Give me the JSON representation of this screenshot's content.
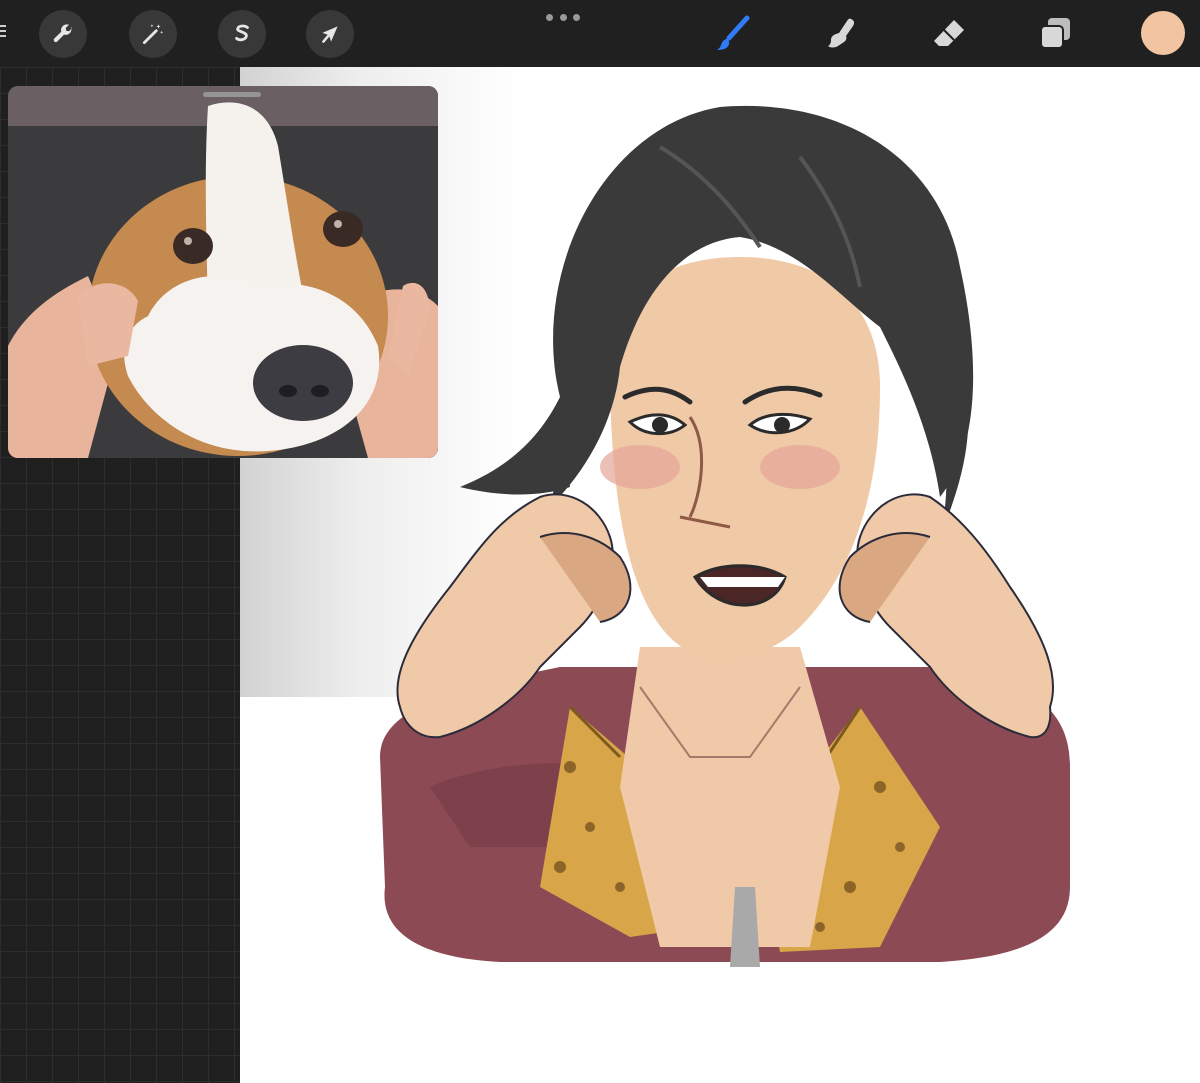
{
  "app": {
    "toolbar": {
      "left_tools": [
        {
          "name": "actions",
          "icon": "wrench-icon"
        },
        {
          "name": "adjustments",
          "icon": "magic-wand-icon"
        },
        {
          "name": "selection",
          "icon": "selection-s-icon"
        },
        {
          "name": "transform",
          "icon": "arrow-cursor-icon"
        }
      ],
      "more_menu_icon": "more-dots-icon",
      "right_tools": [
        {
          "name": "brush",
          "icon": "brush-icon",
          "active": true
        },
        {
          "name": "smudge",
          "icon": "smudge-finger-icon",
          "active": false
        },
        {
          "name": "eraser",
          "icon": "eraser-icon",
          "active": false
        },
        {
          "name": "layers",
          "icon": "layers-icon",
          "active": false
        }
      ],
      "current_color": "#f2c4a1",
      "active_tool_color": "#2f7cf6"
    },
    "reference_window": {
      "subject": "reference-photo-beagle"
    },
    "canvas": {
      "artwork": "character-illustration"
    }
  }
}
